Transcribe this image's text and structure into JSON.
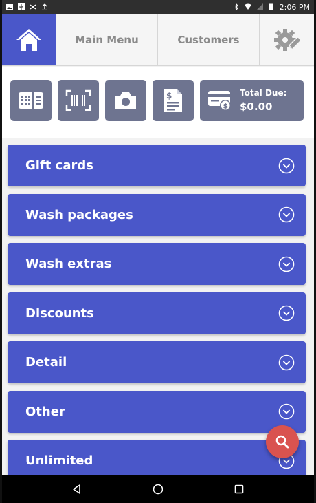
{
  "status_bar": {
    "time": "2:06 PM",
    "left_icons": [
      "image-icon",
      "usb-icon",
      "wifi-off-icon",
      "upload-icon"
    ],
    "right_icons": [
      "bluetooth-icon",
      "wifi-icon",
      "signal-icon",
      "battery-icon"
    ]
  },
  "nav": {
    "home_icon": "home-icon",
    "tabs": [
      {
        "label": "Main Menu"
      },
      {
        "label": "Customers"
      }
    ],
    "settings_icon": "gear-wrench-icon"
  },
  "toolbar": {
    "buttons": [
      {
        "icon": "card-reader-icon"
      },
      {
        "icon": "barcode-scanner-icon"
      },
      {
        "icon": "camera-icon"
      },
      {
        "icon": "invoice-icon"
      }
    ],
    "total_due_label": "Total Due:",
    "total_due_value": "$0.00",
    "total_icon": "payment-card-dollar-icon"
  },
  "categories": [
    {
      "label": "Gift cards"
    },
    {
      "label": "Wash packages"
    },
    {
      "label": "Wash extras"
    },
    {
      "label": "Discounts"
    },
    {
      "label": "Detail"
    },
    {
      "label": "Other"
    },
    {
      "label": "Unlimited"
    }
  ],
  "fab_icon": "search-icon",
  "colors": {
    "primary": "#4a57c9",
    "tool_button": "#6e7490",
    "fab": "#d9534f",
    "tab_text": "#8a8a8a"
  }
}
